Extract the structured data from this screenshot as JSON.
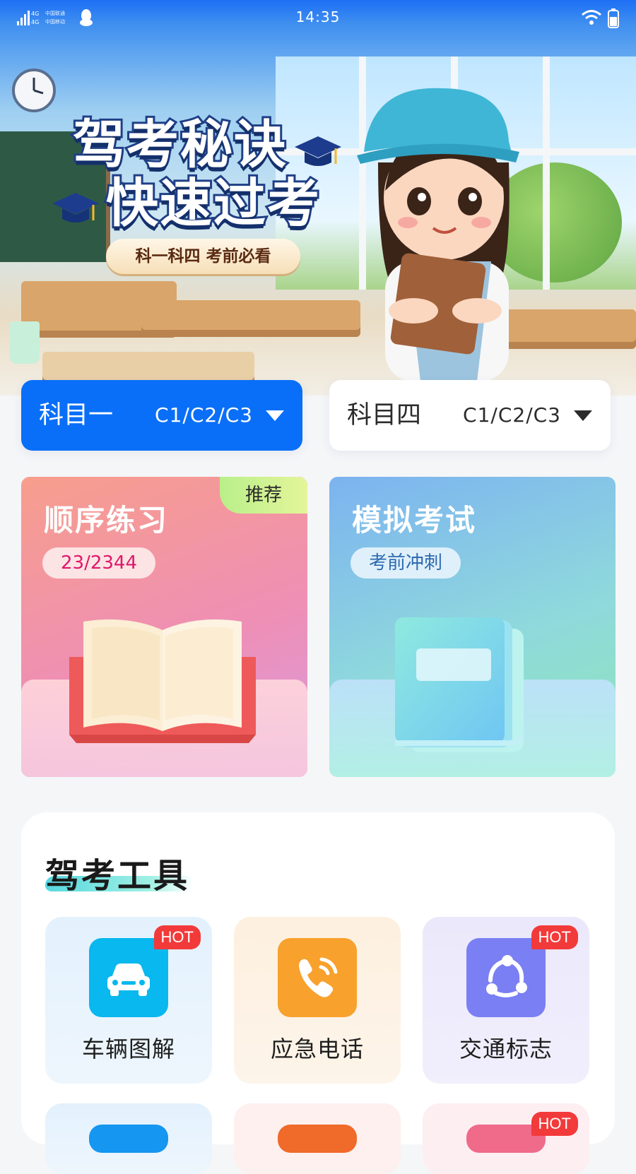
{
  "status_bar": {
    "time": "14:35",
    "carrier_line1": "中国联通",
    "carrier_line2": "中国移动",
    "net1": "4G",
    "net2": "4G"
  },
  "banner": {
    "title_line1": "驾考秘诀",
    "title_line2": "快速过考",
    "subtitle": "科一科四 考前必看"
  },
  "subjects": [
    {
      "name": "科目一",
      "license": "C1/C2/C3",
      "active": true
    },
    {
      "name": "科目四",
      "license": "C1/C2/C3",
      "active": false
    }
  ],
  "practice_cards": [
    {
      "title": "顺序练习",
      "pill": "23/2344",
      "badge": "推荐",
      "progress_done": 23,
      "progress_total": 2344
    },
    {
      "title": "模拟考试",
      "pill": "考前冲刺"
    }
  ],
  "tools": {
    "title": "驾考工具",
    "items": [
      {
        "label": "车辆图解",
        "icon": "car-icon",
        "hot": "HOT",
        "color": "#08b8ef"
      },
      {
        "label": "应急电话",
        "icon": "phone-icon",
        "color": "#f8a12c"
      },
      {
        "label": "交通标志",
        "icon": "share-nodes-icon",
        "hot": "HOT",
        "color": "#7a7ff3"
      }
    ],
    "partial_hot": "HOT"
  },
  "colors": {
    "accent": "#0a6ff8",
    "hot": "#f23a3a",
    "pink_text": "#e0176b"
  }
}
